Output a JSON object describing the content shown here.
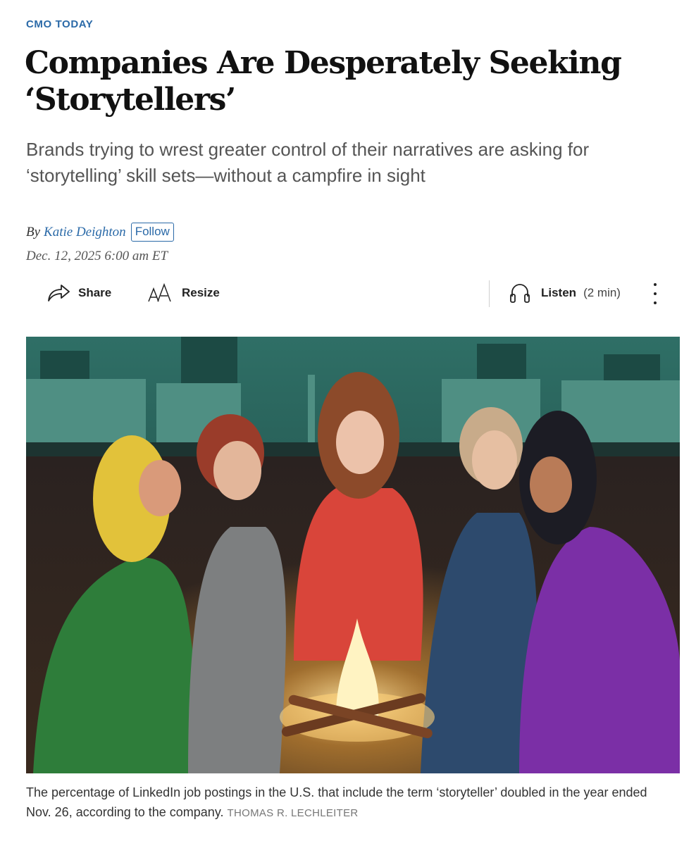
{
  "article": {
    "kicker": "CMO TODAY",
    "headline": "Companies Are Desperately Seeking ‘Storytellers’",
    "dek": "Brands trying to wrest greater control of their narratives are asking for ‘storytelling’ skill sets—without a campfire in sight",
    "byline_prefix": "By",
    "author": "Katie Deighton",
    "follow_label": "Follow",
    "date": "Dec. 12, 2025 6:00 am ET"
  },
  "toolbar": {
    "share_label": "Share",
    "resize_label": "Resize",
    "listen_label": "Listen",
    "listen_duration": "(2 min)",
    "icons": [
      "share-arrow-icon",
      "resize-text-icon",
      "headphones-icon",
      "more-vertical-icon"
    ]
  },
  "hero": {
    "caption": "The percentage of LinkedIn job postings in the U.S. that include the term ‘storyteller’ doubled in the year ended Nov. 26, according to the company.",
    "credit": "THOMAS R. LECHLEITER"
  },
  "colors": {
    "accent": "#2b6aa8",
    "headline": "#111111",
    "dek": "#555555"
  }
}
